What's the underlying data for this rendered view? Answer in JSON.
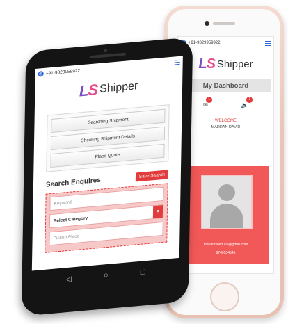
{
  "iphone": {
    "contact": "+91-9829959922",
    "logo_letters": "LS",
    "logo_text": "Shipper",
    "dashboard_title": "My Dashboard",
    "mail_badge": "1",
    "notif_badge": "1",
    "welcome": "WELCOME",
    "user_name": "MARRAN DAVID",
    "email": "marlandavid005@gmail.com",
    "phone": "9749534545"
  },
  "android": {
    "contact": "+91-9829959922",
    "logo_letters": "LS",
    "logo_text": "Shipper",
    "menu": [
      "Searching Shipment",
      "Checking Shipment Details",
      "Place Quote"
    ],
    "search_title": "Search Enquires",
    "save_search": "Save Search",
    "keyword_placeholder": "Keyword",
    "category_value": "Select Category",
    "pickup_placeholder": "Pickup Place"
  },
  "colors": {
    "accent": "#e23b3b",
    "brand_purple": "#7a4cc7",
    "brand_pink": "#e64a8b"
  }
}
